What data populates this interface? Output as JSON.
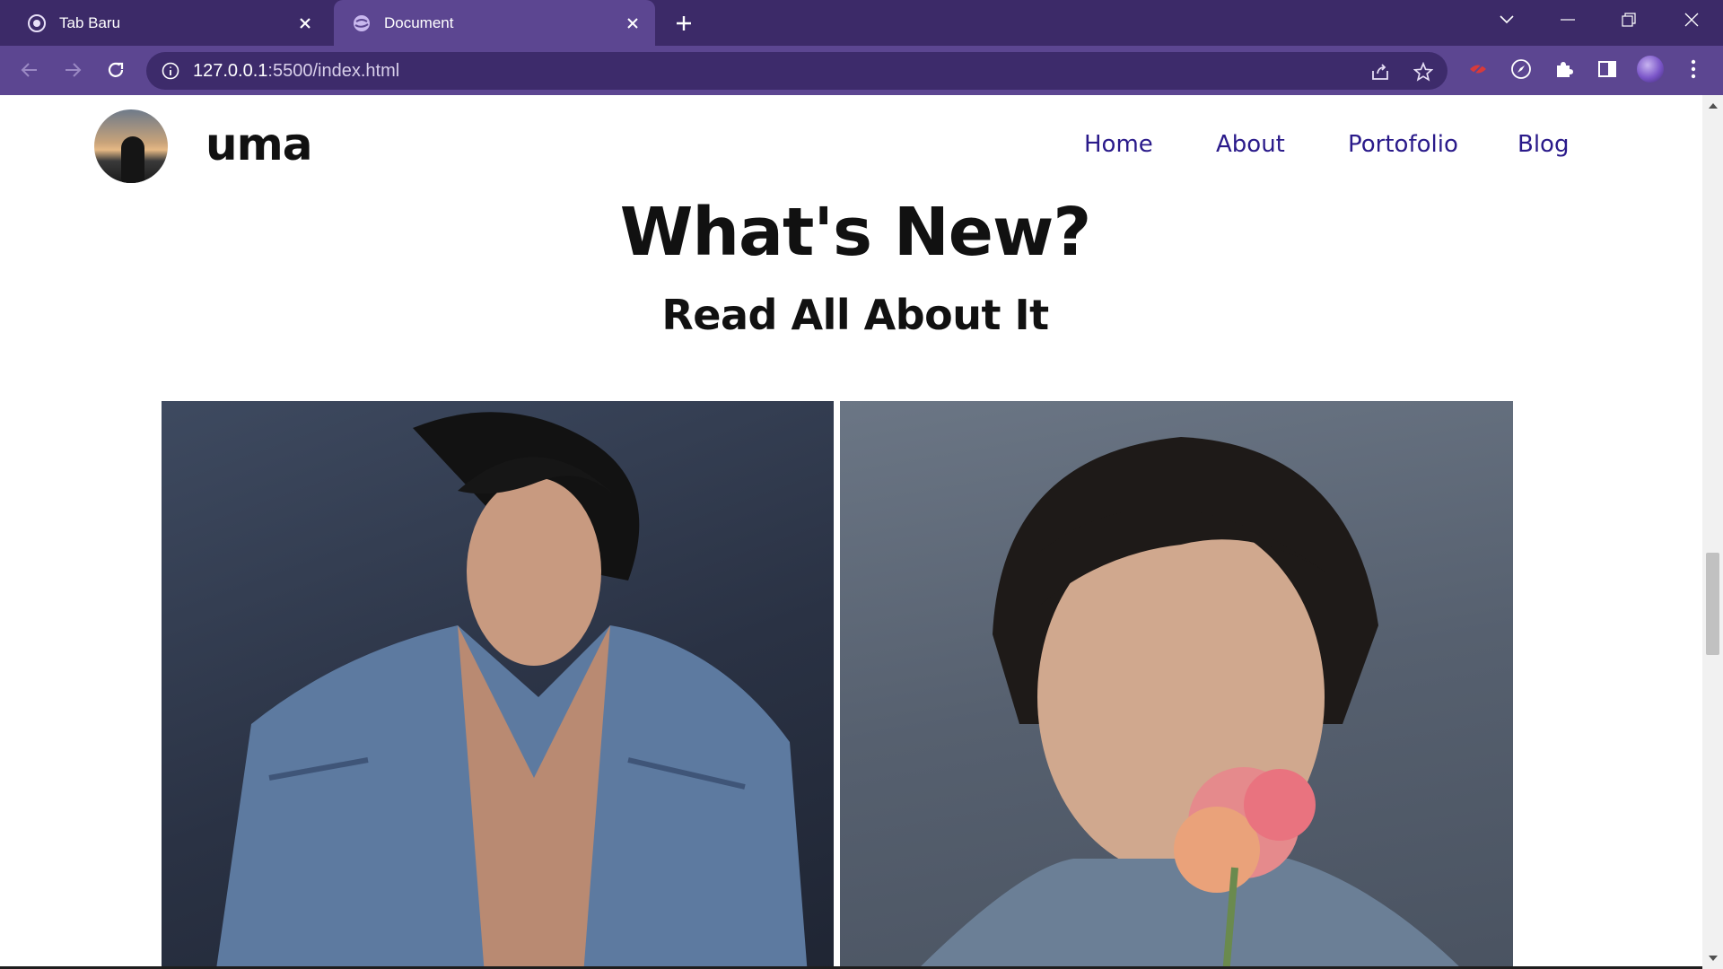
{
  "browser": {
    "tabs": [
      {
        "label": "Tab Baru",
        "icon": "chrome-icon",
        "active": false
      },
      {
        "label": "Document",
        "icon": "globe-icon",
        "active": true
      }
    ],
    "address": {
      "host": "127.0.0.1",
      "rest": ":5500/index.html"
    },
    "colors": {
      "tabbar": "#3c2a68",
      "toolbar": "#5c4691",
      "omnibox": "#3d2b6b"
    }
  },
  "site": {
    "brand": "uma",
    "nav": [
      "Home",
      "About",
      "Portofolio",
      "Blog"
    ],
    "title": "What's New?",
    "subtitle": "Read All About It",
    "nav_color": "#2a1a8a"
  }
}
